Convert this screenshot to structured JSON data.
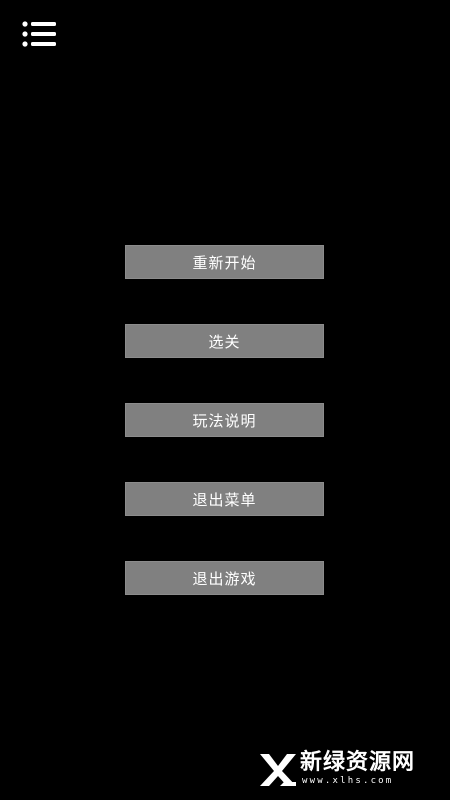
{
  "header": {
    "menu_icon": "list-menu-icon"
  },
  "menu": {
    "buttons": [
      {
        "label": "重新开始"
      },
      {
        "label": "选关"
      },
      {
        "label": "玩法说明"
      },
      {
        "label": "退出菜单"
      },
      {
        "label": "退出游戏"
      }
    ]
  },
  "watermark": {
    "logo_icon": "xl-logo-icon",
    "title": "新绿资源网",
    "subtitle": "www.xlhs.com"
  },
  "colors": {
    "background": "#000000",
    "button": "#808080",
    "button_text": "#ffffff"
  }
}
